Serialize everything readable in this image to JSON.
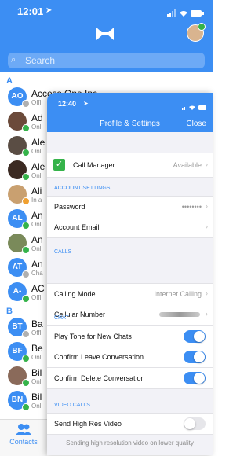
{
  "status_bar": {
    "time": "12:01"
  },
  "search": {
    "placeholder": "Search"
  },
  "contacts": {
    "sections": [
      {
        "letter": "A",
        "items": [
          {
            "initials": "AO",
            "name": "Access One Inc",
            "status": "Offl",
            "avatar_color": "#3c8ef3",
            "badge": "offline"
          },
          {
            "initials": "",
            "name": "Ad",
            "status": "Onl",
            "avatar_color": "#6b4a3a",
            "badge": "online"
          },
          {
            "initials": "",
            "name": "Ale",
            "status": "Onl",
            "avatar_color": "#5a4d44",
            "badge": "online"
          },
          {
            "initials": "",
            "name": "Ale",
            "status": "Onl",
            "avatar_color": "#3b2a22",
            "badge": "online"
          },
          {
            "initials": "",
            "name": "Ali",
            "status": "In a",
            "avatar_color": "#c9a070",
            "badge": "busy"
          },
          {
            "initials": "AL",
            "name": "An",
            "status": "Onl",
            "avatar_color": "#3c8ef3",
            "badge": "online"
          },
          {
            "initials": "",
            "name": "An",
            "status": "Onl",
            "avatar_color": "#7a8a5a",
            "badge": "online"
          },
          {
            "initials": "AT",
            "name": "An",
            "status": "Cha",
            "avatar_color": "#3c8ef3",
            "badge": "chat"
          },
          {
            "initials": "A-",
            "name": "AC",
            "status": "Offl",
            "avatar_color": "#3c8ef3",
            "badge": "online"
          }
        ]
      },
      {
        "letter": "B",
        "items": [
          {
            "initials": "BT",
            "name": "Ba",
            "status": "Offl",
            "avatar_color": "#3c8ef3",
            "badge": "offline"
          },
          {
            "initials": "BF",
            "name": "Be",
            "status": "Onl",
            "avatar_color": "#3c8ef3",
            "badge": "online"
          },
          {
            "initials": "",
            "name": "Bil",
            "status": "Onl",
            "avatar_color": "#8a6a5a",
            "badge": "online"
          },
          {
            "initials": "BN",
            "name": "Bil",
            "status": "Onl",
            "avatar_color": "#3c8ef3",
            "badge": "online"
          }
        ]
      }
    ]
  },
  "tab_bar": {
    "contacts_label": "Contacts"
  },
  "sheet": {
    "status_time": "12:40",
    "title": "Profile & Settings",
    "close_label": "Close",
    "call_manager": {
      "label": "Call Manager",
      "value": "Available"
    },
    "account_settings": {
      "header": "ACCOUNT SETTINGS",
      "password_label": "Password",
      "password_value": "••••••••",
      "email_label": "Account Email"
    },
    "calls": {
      "header": "CALLS",
      "calling_mode_label": "Calling Mode",
      "calling_mode_value": "Internet Calling",
      "cellular_label": "Cellular Number"
    },
    "chat": {
      "header": "CHAT",
      "toggles": [
        {
          "label": "Play Tone for New Chats",
          "on": true
        },
        {
          "label": "Confirm Leave Conversation",
          "on": true
        },
        {
          "label": "Confirm Delete Conversation",
          "on": true
        }
      ]
    },
    "video_calls": {
      "header": "VIDEO CALLS",
      "hi_res_label": "Send High Res Video",
      "hi_res_on": false,
      "footnote": "Sending high resolution video on lower quality"
    }
  },
  "colors": {
    "accent": "#3c8ef3",
    "online": "#35b34a",
    "offline": "#b0b0b0",
    "busy": "#f0a030"
  }
}
